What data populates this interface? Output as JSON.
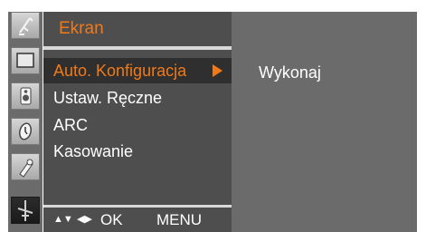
{
  "menu": {
    "title": "Ekran",
    "items": [
      {
        "label": "Auto. Konfiguracja",
        "selected": true
      },
      {
        "label": "Ustaw. Ręczne",
        "selected": false
      },
      {
        "label": "ARC",
        "selected": false
      },
      {
        "label": "Kasowanie",
        "selected": false
      }
    ]
  },
  "submenu": {
    "value": "Wykonaj"
  },
  "hint": {
    "updown": "▲▼",
    "leftright": "◀▶",
    "ok": "OK",
    "menu": "MENU"
  },
  "sidebar": {
    "icons": [
      "satellite-icon",
      "screen-icon",
      "speaker-icon",
      "clock-icon",
      "key-icon",
      "setup-icon"
    ],
    "active": "setup-icon"
  },
  "colors": {
    "accent": "#f07a1a",
    "panel": "#4e4e4e",
    "sidebar": "#6b6b6b",
    "selected_row": "#2f2f2f"
  }
}
